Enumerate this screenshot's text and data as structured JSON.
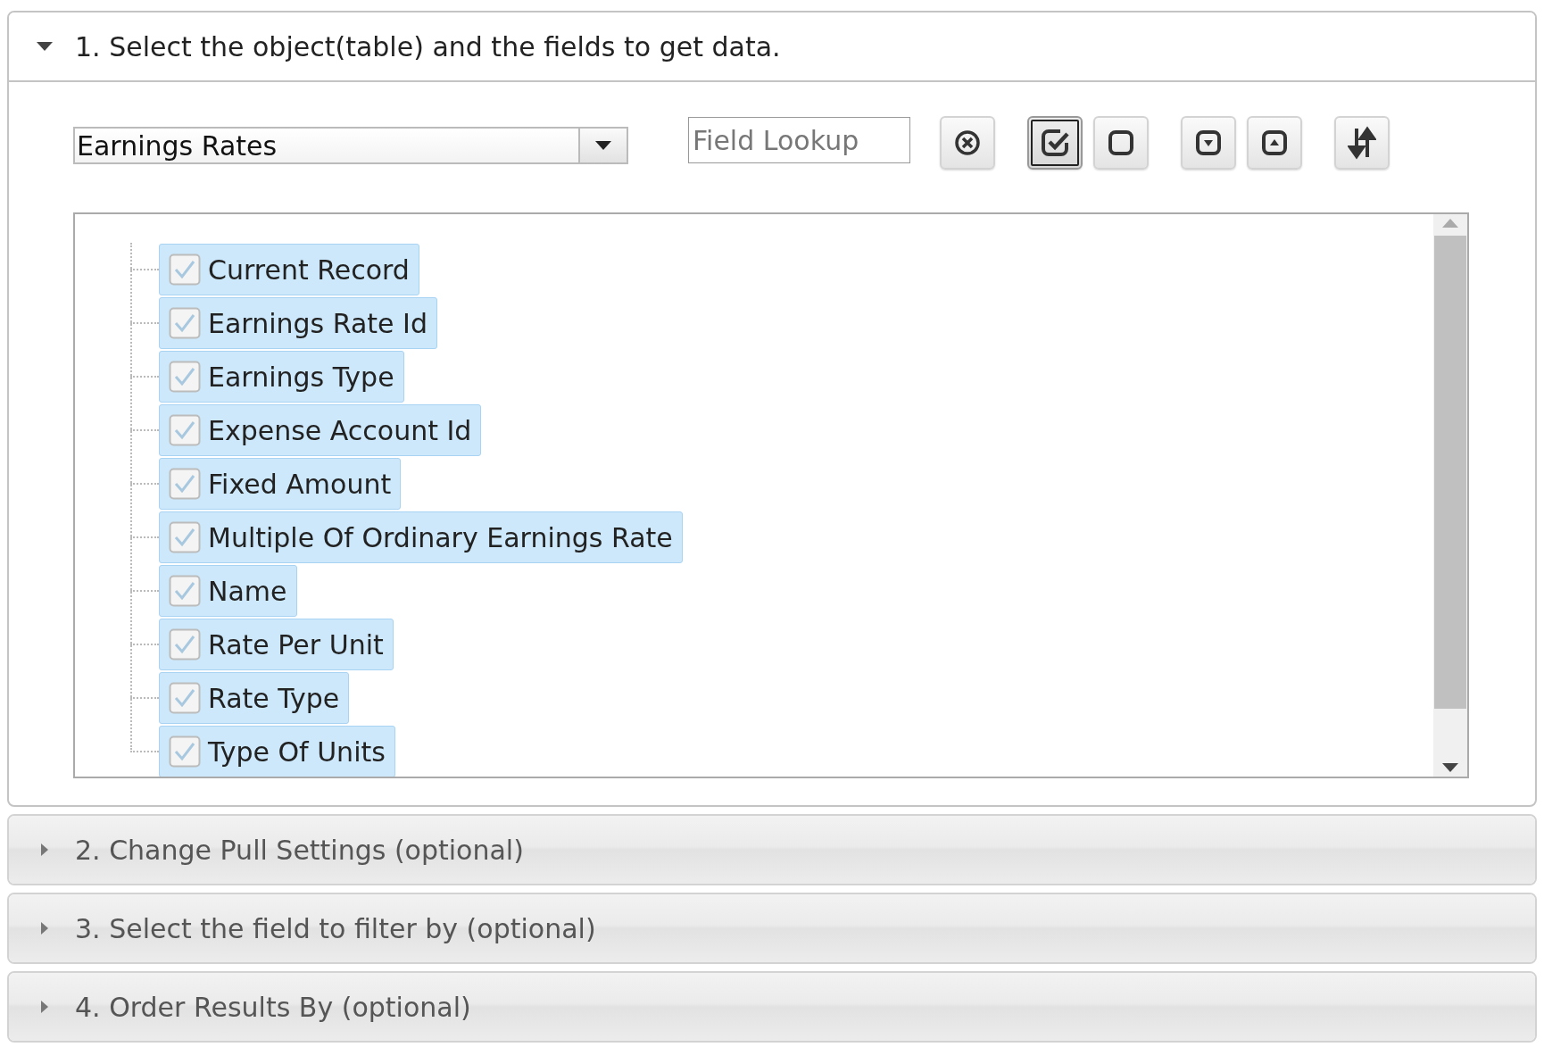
{
  "sections": [
    {
      "title": "1. Select the object(table) and the fields to get data.",
      "expanded": true,
      "object_select": {
        "value": "Earnings Rates"
      },
      "field_lookup": {
        "placeholder": "Field Lookup"
      },
      "toolbar": [
        {
          "kind": "clear",
          "pressed": false
        },
        {
          "kind": "check-all",
          "pressed": true
        },
        {
          "kind": "uncheck-all",
          "pressed": false
        },
        {
          "kind": "expand",
          "pressed": false
        },
        {
          "kind": "collapse",
          "pressed": false
        },
        {
          "kind": "sort",
          "pressed": false
        }
      ],
      "fields": [
        {
          "label": "Current Record",
          "checked": true,
          "selected": true
        },
        {
          "label": "Earnings Rate Id",
          "checked": true,
          "selected": true
        },
        {
          "label": "Earnings Type",
          "checked": true,
          "selected": true
        },
        {
          "label": "Expense Account Id",
          "checked": true,
          "selected": true
        },
        {
          "label": "Fixed Amount",
          "checked": true,
          "selected": true
        },
        {
          "label": "Multiple Of Ordinary Earnings Rate",
          "checked": true,
          "selected": true
        },
        {
          "label": "Name",
          "checked": true,
          "selected": true
        },
        {
          "label": "Rate Per Unit",
          "checked": true,
          "selected": true
        },
        {
          "label": "Rate Type",
          "checked": true,
          "selected": true
        },
        {
          "label": "Type Of Units",
          "checked": true,
          "selected": true
        }
      ]
    },
    {
      "title": "2. Change Pull Settings (optional)",
      "expanded": false
    },
    {
      "title": "3. Select the field to filter by (optional)",
      "expanded": false
    },
    {
      "title": "4. Order Results By (optional)",
      "expanded": false
    }
  ]
}
